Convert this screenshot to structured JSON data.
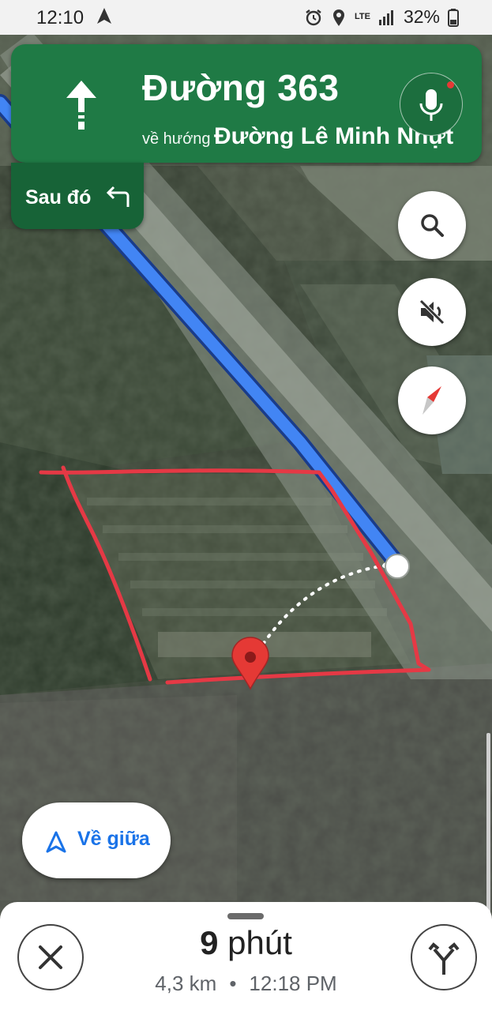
{
  "status_bar": {
    "time": "12:10",
    "network": "LTE",
    "battery": "32%"
  },
  "navigation": {
    "street": "Đường 363",
    "toward_prefix": "về hướng",
    "toward_destination": "Đường Lê Minh Nhựt",
    "then_label": "Sau đó",
    "card_color": "#1f7a45"
  },
  "map": {
    "route_color": "#4285f4",
    "boundary_color": "#e53945"
  },
  "controls": {
    "recenter_label": "Về giữa"
  },
  "trip": {
    "duration_value": "9",
    "duration_unit": "phút",
    "distance": "4,3 km",
    "separator": "•",
    "arrival_time": "12:18 PM"
  }
}
